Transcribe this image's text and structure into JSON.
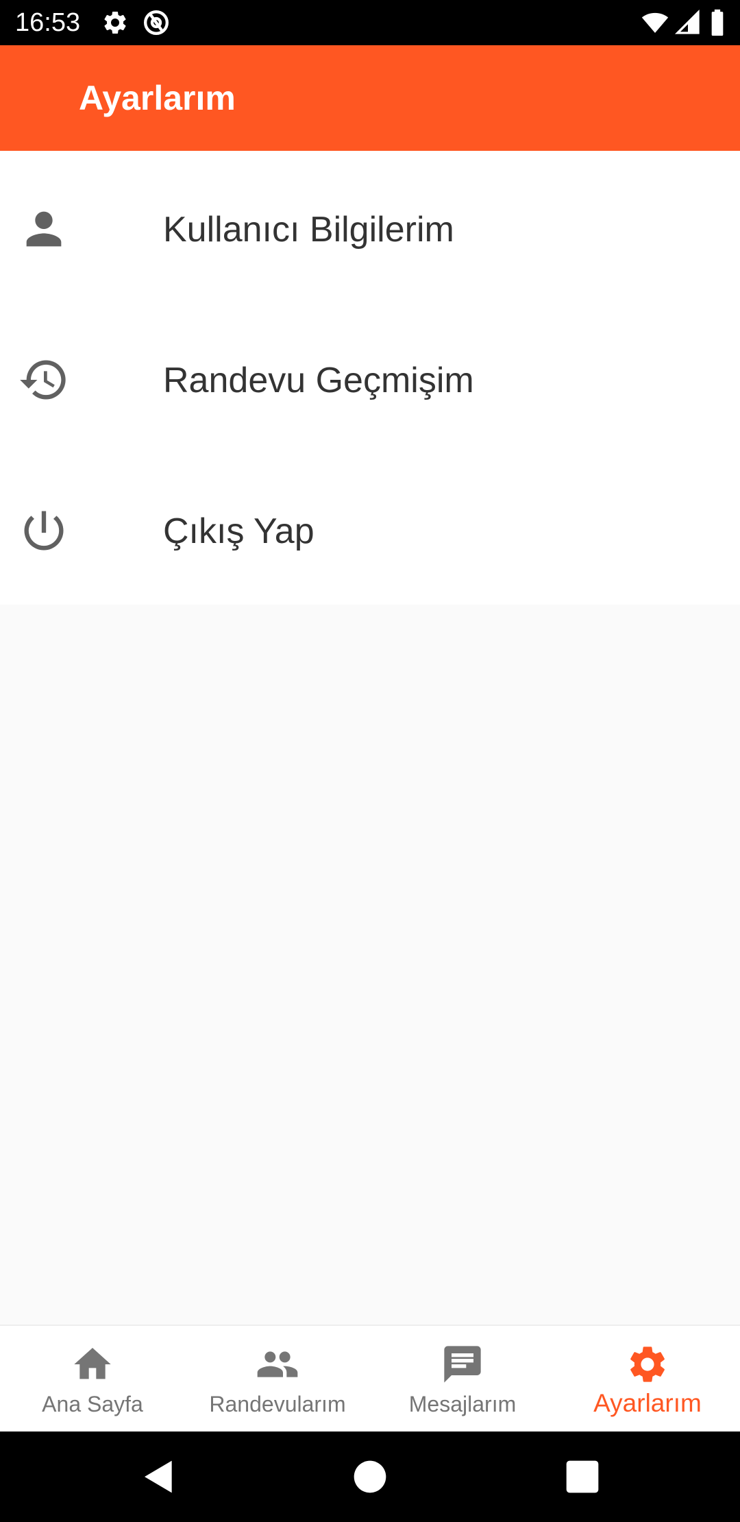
{
  "status_bar": {
    "time": "16:53",
    "icons": [
      "gear-icon",
      "at-sign-icon",
      "wifi-icon",
      "signal-icon",
      "battery-icon"
    ]
  },
  "app_bar": {
    "title": "Ayarlarım",
    "background": "#ff5722"
  },
  "settings_list": {
    "items": [
      {
        "label": "Kullanıcı Bilgilerim",
        "icon": "person-icon"
      },
      {
        "label": "Randevu Geçmişim",
        "icon": "history-icon"
      },
      {
        "label": "Çıkış Yap",
        "icon": "power-icon"
      }
    ]
  },
  "bottom_nav": {
    "active_color": "#ff5722",
    "inactive_color": "#757575",
    "items": [
      {
        "label": "Ana Sayfa",
        "icon": "home-icon",
        "active": false
      },
      {
        "label": "Randevularım",
        "icon": "group-icon",
        "active": false
      },
      {
        "label": "Mesajlarım",
        "icon": "message-icon",
        "active": false
      },
      {
        "label": "Ayarlarım",
        "icon": "gear-icon",
        "active": true
      }
    ]
  },
  "system_nav": {
    "buttons": [
      "back-icon",
      "home-circle-icon",
      "recents-icon"
    ]
  }
}
